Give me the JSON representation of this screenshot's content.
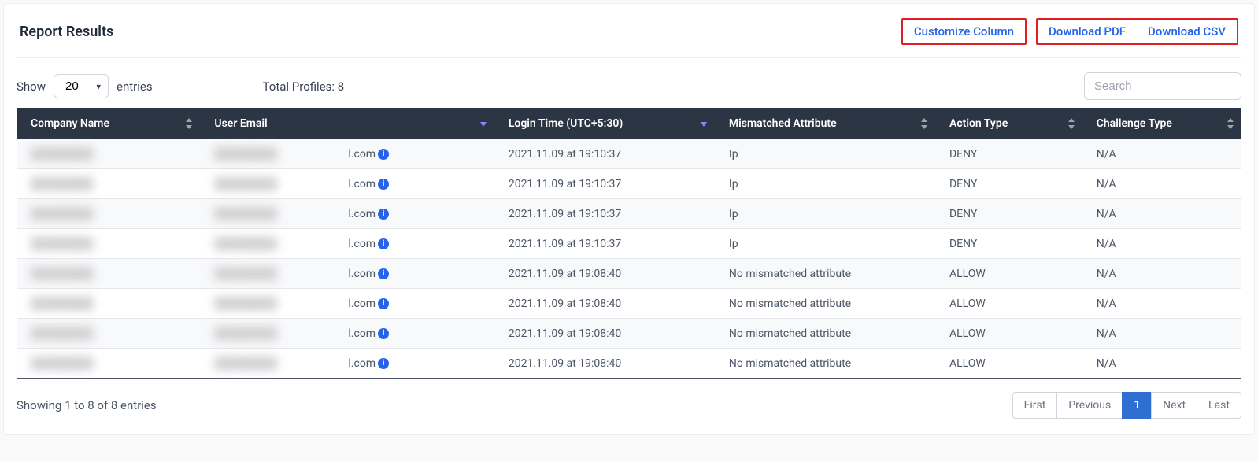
{
  "header": {
    "title": "Report Results",
    "customize": "Customize Column",
    "download_pdf": "Download PDF",
    "download_csv": "Download CSV"
  },
  "controls": {
    "show_label_prefix": "Show",
    "show_label_suffix": "entries",
    "page_size_value": "20",
    "total_profiles_label": "Total Profiles: 8",
    "search_placeholder": "Search"
  },
  "columns": {
    "company": "Company Name",
    "email": "User Email",
    "login": "Login Time (UTC+5:30)",
    "mismatch": "Mismatched Attribute",
    "action": "Action Type",
    "challenge": "Challenge Type"
  },
  "rows": [
    {
      "company": "████████",
      "email_masked": "████████",
      "email_suffix": "l.com",
      "login": "2021.11.09 at 19:10:37",
      "mismatch": "Ip",
      "action": "DENY",
      "challenge": "N/A"
    },
    {
      "company": "████████",
      "email_masked": "████████",
      "email_suffix": "l.com",
      "login": "2021.11.09 at 19:10:37",
      "mismatch": "Ip",
      "action": "DENY",
      "challenge": "N/A"
    },
    {
      "company": "████████",
      "email_masked": "████████",
      "email_suffix": "l.com",
      "login": "2021.11.09 at 19:10:37",
      "mismatch": "Ip",
      "action": "DENY",
      "challenge": "N/A"
    },
    {
      "company": "████████",
      "email_masked": "████████",
      "email_suffix": "l.com",
      "login": "2021.11.09 at 19:10:37",
      "mismatch": "Ip",
      "action": "DENY",
      "challenge": "N/A"
    },
    {
      "company": "████████",
      "email_masked": "████████",
      "email_suffix": "l.com",
      "login": "2021.11.09 at 19:08:40",
      "mismatch": "No mismatched attribute",
      "action": "ALLOW",
      "challenge": "N/A"
    },
    {
      "company": "████████",
      "email_masked": "████████",
      "email_suffix": "l.com",
      "login": "2021.11.09 at 19:08:40",
      "mismatch": "No mismatched attribute",
      "action": "ALLOW",
      "challenge": "N/A"
    },
    {
      "company": "████████",
      "email_masked": "████████",
      "email_suffix": "l.com",
      "login": "2021.11.09 at 19:08:40",
      "mismatch": "No mismatched attribute",
      "action": "ALLOW",
      "challenge": "N/A"
    },
    {
      "company": "████████",
      "email_masked": "████████",
      "email_suffix": "l.com",
      "login": "2021.11.09 at 19:08:40",
      "mismatch": "No mismatched attribute",
      "action": "ALLOW",
      "challenge": "N/A"
    }
  ],
  "footer": {
    "summary": "Showing 1 to 8 of 8 entries"
  },
  "pagination": {
    "first": "First",
    "previous": "Previous",
    "page_1": "1",
    "next": "Next",
    "last": "Last"
  },
  "icons": {
    "info_glyph": "i"
  }
}
